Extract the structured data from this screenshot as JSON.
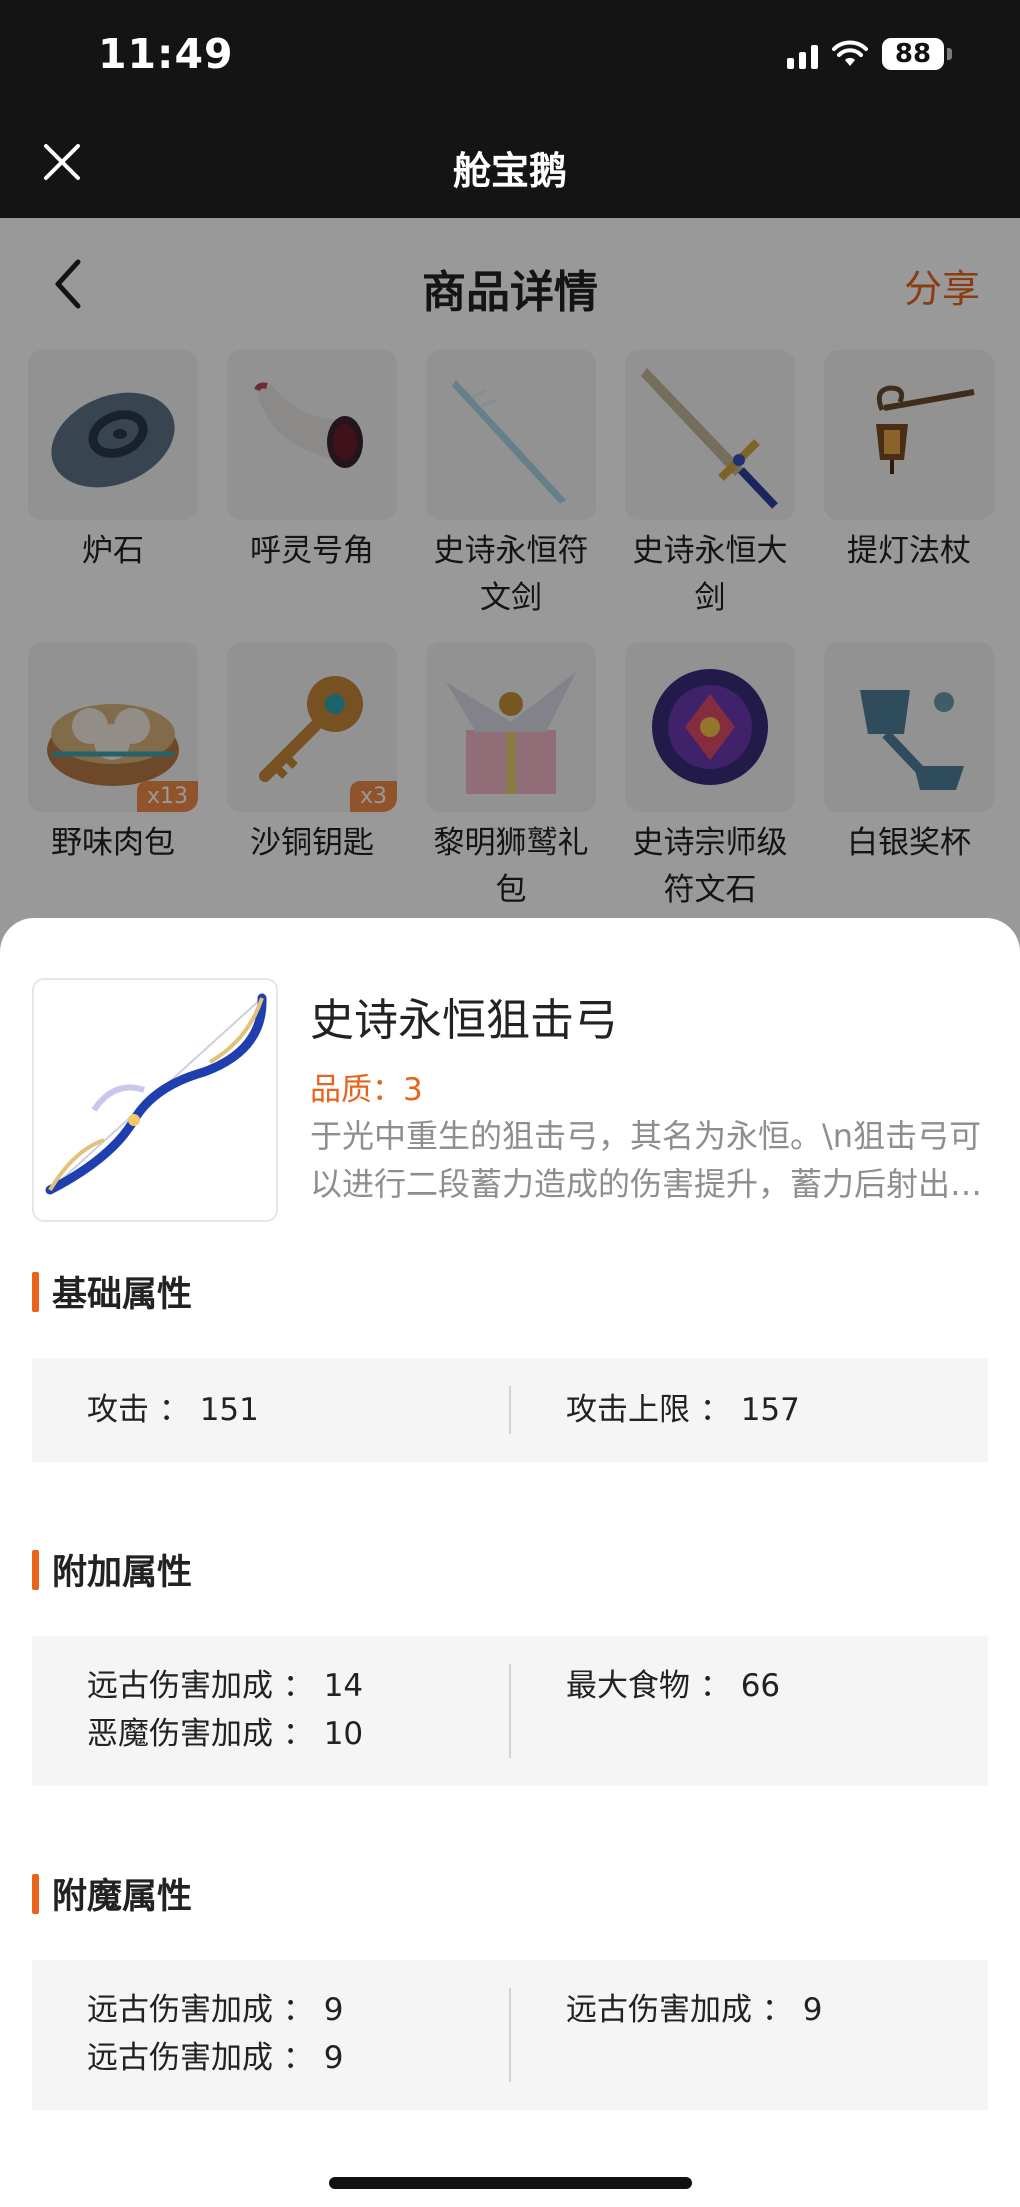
{
  "status_bar": {
    "time": "11:49",
    "battery": "88"
  },
  "app_bar": {
    "title": "舱宝鹅"
  },
  "nav": {
    "title": "商品详情",
    "share": "分享"
  },
  "grid_items": [
    {
      "label": "炉石",
      "icon": "stone-icon",
      "badge": ""
    },
    {
      "label": "呼灵号角",
      "icon": "horn-icon",
      "badge": ""
    },
    {
      "label": "史诗永恒符文剑",
      "icon": "rune-sword-icon",
      "badge": ""
    },
    {
      "label": "史诗永恒大剑",
      "icon": "greatsword-icon",
      "badge": ""
    },
    {
      "label": "提灯法杖",
      "icon": "lantern-staff-icon",
      "badge": ""
    },
    {
      "label": "野味肉包",
      "icon": "meat-bun-icon",
      "badge": "x13"
    },
    {
      "label": "沙铜钥匙",
      "icon": "bronze-key-icon",
      "badge": "x3"
    },
    {
      "label": "黎明狮鹫礼包",
      "icon": "griffin-gift-icon",
      "badge": ""
    },
    {
      "label": "史诗宗师级符文石",
      "icon": "rune-stone-icon",
      "badge": ""
    },
    {
      "label": "白银奖杯",
      "icon": "silver-trophy-icon",
      "badge": ""
    }
  ],
  "product": {
    "name": "史诗永恒狙击弓",
    "quality": "品质：3",
    "description": "于光中重生的狙击弓，其名为永恒。\\n狙击弓可以进行二段蓄力造成的伤害提升，蓄力后射出的箭矢伤害更高。",
    "image_icon": "bow-icon"
  },
  "sections": {
    "basic": {
      "title": "基础属性",
      "left": [
        "攻击 ： 151"
      ],
      "right": [
        "攻击上限 ： 157"
      ]
    },
    "extra": {
      "title": "附加属性",
      "left": [
        "远古伤害加成 ： 14",
        "恶魔伤害加成 ： 10"
      ],
      "right": [
        "最大食物 ： 66"
      ]
    },
    "enchant": {
      "title": "附魔属性",
      "left": [
        "远古伤害加成 ： 9",
        "远古伤害加成 ： 9"
      ],
      "right": [
        "远古伤害加成 ： 9"
      ]
    }
  },
  "colors": {
    "accent": "#e8641c",
    "header_bg": "#141414",
    "attr_bg": "#f5f5f5"
  }
}
